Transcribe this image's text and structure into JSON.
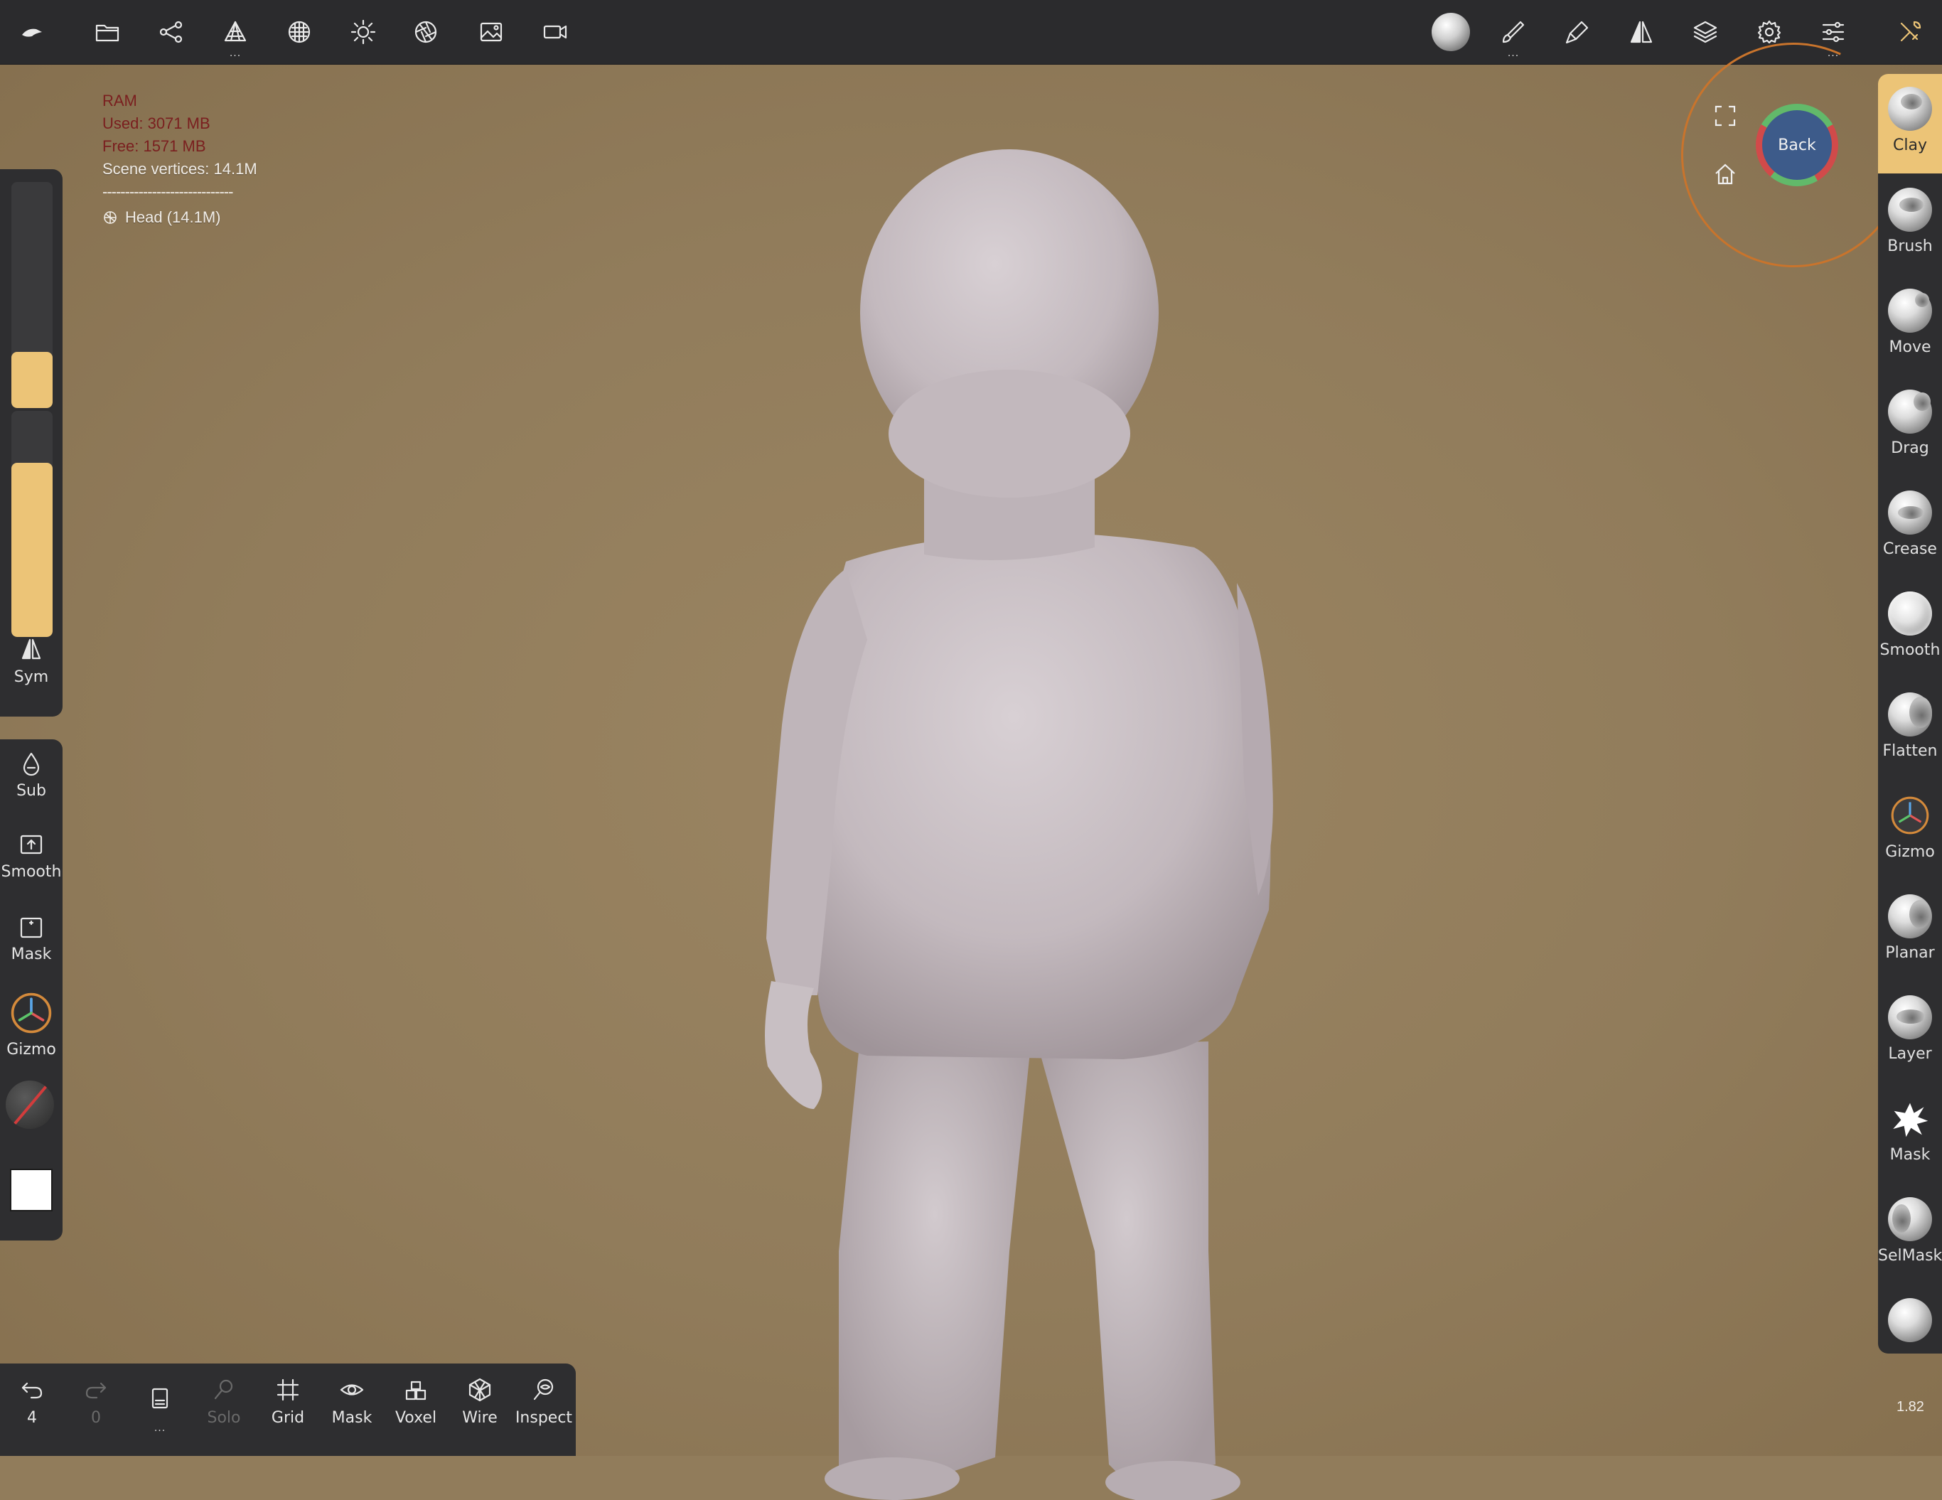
{
  "top_toolbar": {
    "left_icons": [
      "app-logo-icon",
      "folder-icon",
      "scene-graph-icon",
      "topology-icon",
      "material-icon",
      "light-icon",
      "post-process-icon",
      "background-image-icon",
      "camera-icon"
    ],
    "right_icons": [
      "matcap-sphere-icon",
      "paint-brush-icon",
      "stroke-icon",
      "symmetry-icon",
      "layers-icon",
      "settings-icon",
      "sliders-icon",
      "tools-icon"
    ]
  },
  "stats": {
    "ram_label": "RAM",
    "used": "Used:  3071 MB",
    "free": "Free:  1571 MB",
    "vertices": "Scene vertices:  14.1M",
    "separator": "-----------------------------",
    "object": "Head (14.1M)"
  },
  "left_panel": {
    "radius_fill": 0.25,
    "intensity_fill": 0.77,
    "sym_label": "Sym",
    "sub_label": "Sub",
    "smooth_label": "Smooth",
    "mask_label": "Mask",
    "gizmo_label": "Gizmo"
  },
  "tools": [
    {
      "label": "Clay",
      "active": true
    },
    {
      "label": "Brush"
    },
    {
      "label": "Move"
    },
    {
      "label": "Drag"
    },
    {
      "label": "Crease"
    },
    {
      "label": "Smooth"
    },
    {
      "label": "Flatten"
    },
    {
      "label": "Gizmo"
    },
    {
      "label": "Planar"
    },
    {
      "label": "Layer"
    },
    {
      "label": "Mask"
    },
    {
      "label": "SelMask"
    }
  ],
  "bottom_toolbar": {
    "undo_count": "4",
    "redo_count": "0",
    "solo": "Solo",
    "grid": "Grid",
    "mask": "Mask",
    "voxel": "Voxel",
    "wire": "Wire",
    "inspect": "Inspect"
  },
  "nav_cube": {
    "face_label": "Back"
  },
  "zoom_value": "1.82",
  "colors": {
    "accent": "#ecc477",
    "background": "#917c5b",
    "panel": "#2e2e30",
    "model": "#c9c0c4"
  }
}
